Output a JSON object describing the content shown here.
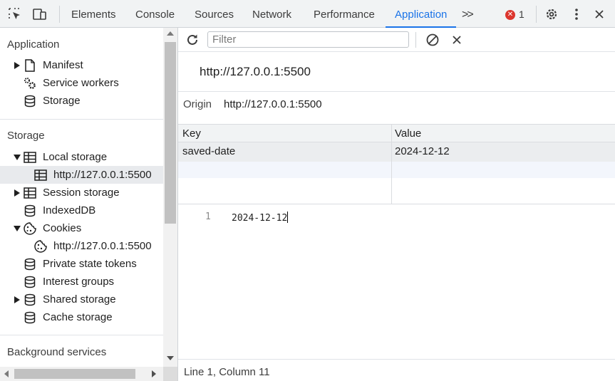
{
  "toolbar": {
    "inspect_icon": "inspect-element-icon",
    "device_icon": "device-toolbar-icon",
    "tabs": [
      "Elements",
      "Console",
      "Sources",
      "Network",
      "Performance",
      "Application"
    ],
    "active_tab": "Application",
    "more_tabs_glyph": ">>",
    "error_count": "1",
    "settings_icon": "gear-icon",
    "menu_icon": "kebab-menu-icon",
    "close_icon": "close-icon",
    "accent_color": "#1a73e8",
    "error_color": "#dc362e"
  },
  "sidebar": {
    "application_section": {
      "title": "Application",
      "items": [
        "Manifest",
        "Service workers",
        "Storage"
      ]
    },
    "storage_section": {
      "title": "Storage",
      "items": [
        "Local storage",
        "http://127.0.0.1:5500",
        "Session storage",
        "IndexedDB",
        "Cookies",
        "http://127.0.0.1:5500",
        "Private state tokens",
        "Interest groups",
        "Shared storage",
        "Cache storage"
      ]
    },
    "background_section": {
      "title": "Background services"
    },
    "selected_item": "http://127.0.0.1:5500"
  },
  "main": {
    "filter_placeholder": "Filter",
    "origin_title": "http://127.0.0.1:5500",
    "origin_label": "Origin",
    "origin_value": "http://127.0.0.1:5500",
    "table": {
      "columns": [
        "Key",
        "Value"
      ],
      "rows": [
        {
          "key": "saved-date",
          "value": "2024-12-12"
        }
      ]
    },
    "editor": {
      "line_number": "1",
      "content": "2024-12-12"
    },
    "status": "Line 1, Column 11"
  }
}
